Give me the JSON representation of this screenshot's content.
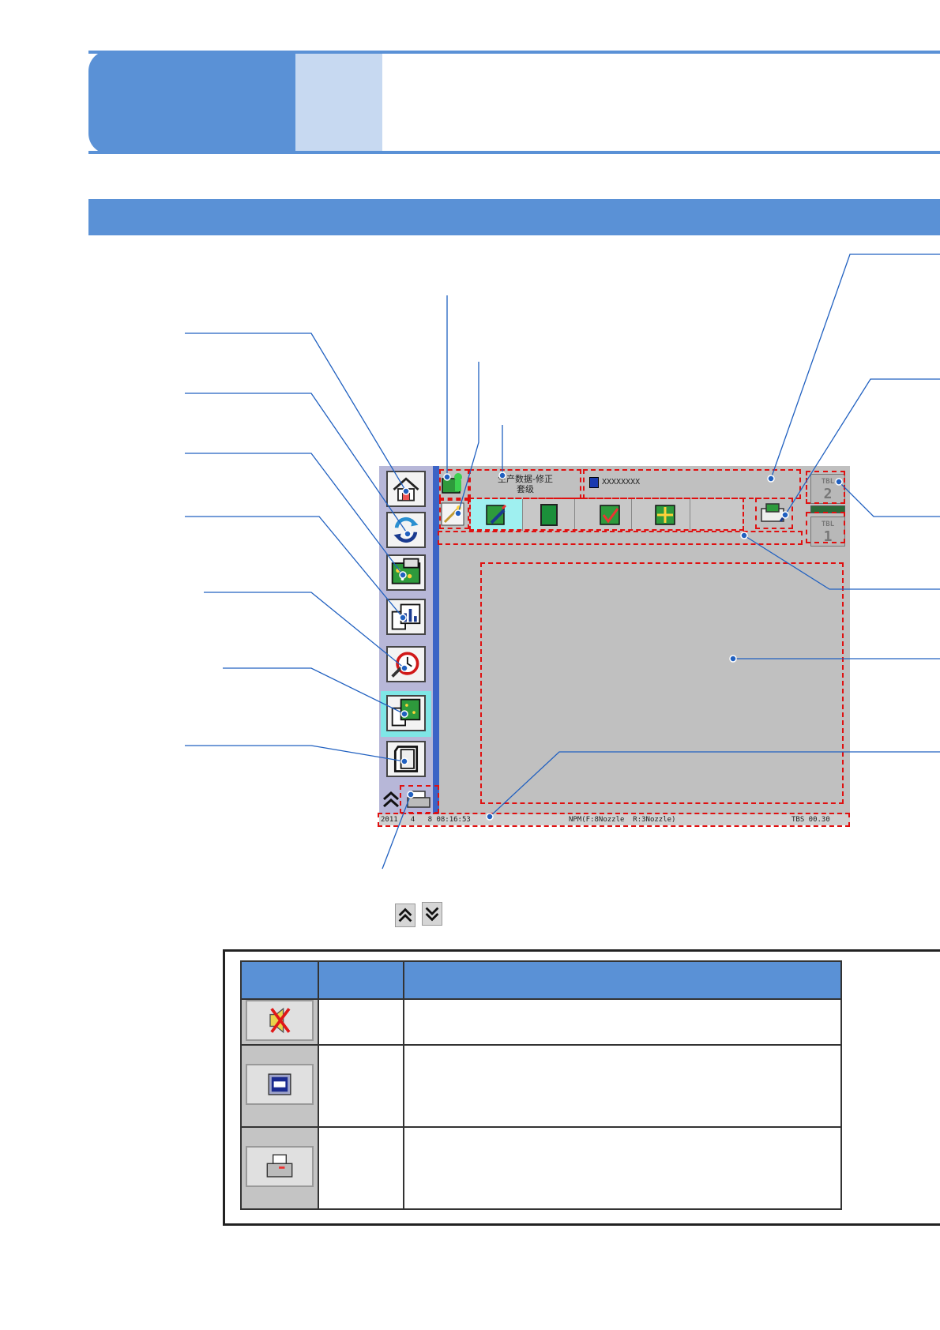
{
  "screen": {
    "header": {
      "production_text_line1": "生产数据-修正",
      "production_text_line2": "套级",
      "file_name": "XXXXXXXX"
    },
    "tbl_buttons": [
      {
        "label": "TBL",
        "number": "2"
      },
      {
        "label": "TBL",
        "number": "1"
      }
    ],
    "status_bar": {
      "date_time": "2011   4   8 08:16:53",
      "nozzle_info": "NPM(F:8Nozzle  R:3Nozzle)",
      "tbs": "TBS 00.30"
    }
  },
  "icons": {
    "left_column": [
      "home-icon",
      "cycle-icon",
      "production-pcb-icon",
      "report-chart-icon",
      "alarm-clock-icon",
      "document-pcb-icon",
      "feeder-cabinet-icon"
    ],
    "toolbar": [
      "magic-wand-icon",
      "edit-pcb-icon",
      "green-square-icon",
      "check-pcb-icon",
      "pcb-adjust-icon",
      "transfer-icon"
    ]
  },
  "legend_table": {
    "rows": [
      {
        "icon": "mute-icon"
      },
      {
        "icon": "memory-icon"
      },
      {
        "icon": "printer-icon"
      }
    ]
  },
  "colors": {
    "accent": "#5a91d6",
    "accent_light": "#c7d9f1",
    "highlight_dash": "#e01010",
    "screen_gray": "#c0c0c0"
  }
}
